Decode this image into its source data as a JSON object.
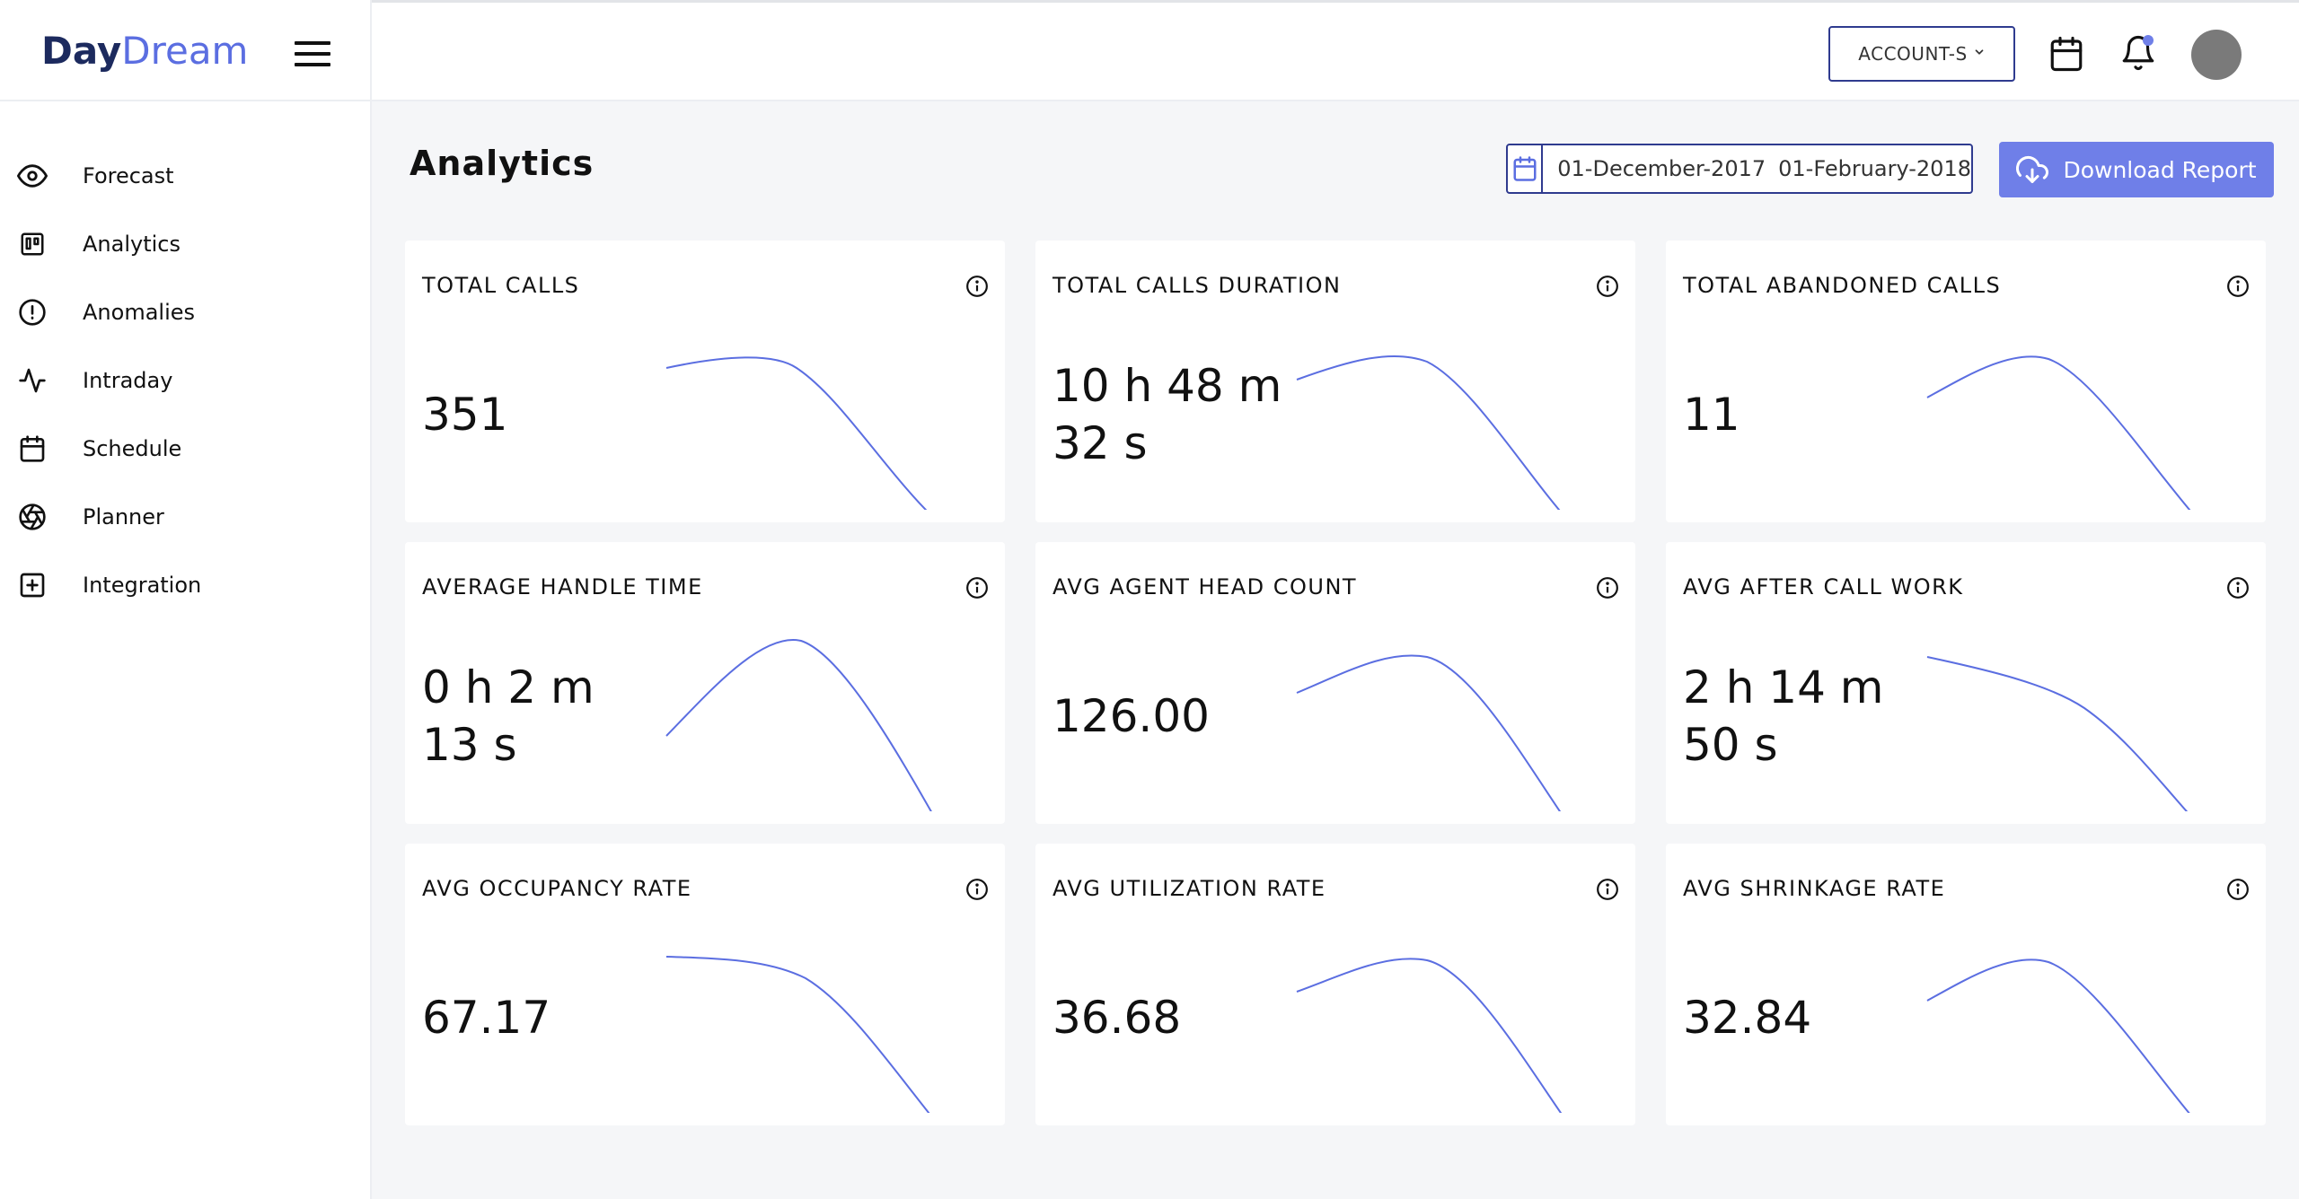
{
  "app": {
    "logo_day": "Day",
    "logo_dream": "Dream"
  },
  "sidebar": {
    "items": [
      {
        "label": "Forecast",
        "icon": "eye-icon"
      },
      {
        "label": "Analytics",
        "icon": "board-icon"
      },
      {
        "label": "Anomalies",
        "icon": "alert-circle-icon"
      },
      {
        "label": "Intraday",
        "icon": "activity-icon"
      },
      {
        "label": "Schedule",
        "icon": "calendar-icon"
      },
      {
        "label": "Planner",
        "icon": "aperture-icon"
      },
      {
        "label": "Integration",
        "icon": "plus-square-icon"
      }
    ]
  },
  "topbar": {
    "account_label": "ACCOUNT-S",
    "notification_dot": true
  },
  "main": {
    "title": "Analytics",
    "date_start": "01-December-2017",
    "date_end": "01-February-2018",
    "download_label": "Download Report"
  },
  "colors": {
    "accent": "#6f7fe8",
    "brand_dark": "#1c2a5e",
    "sparkline": "#5b6ee1"
  },
  "cards": [
    {
      "title": "TOTAL CALLS",
      "value": "351",
      "trend": "rise-fall-late"
    },
    {
      "title": "TOTAL CALLS DURATION",
      "value": "10 h 48 m 32 s",
      "trend": "rise-fall"
    },
    {
      "title": "TOTAL ABANDONED CALLS",
      "value": "11",
      "trend": "rise-fall"
    },
    {
      "title": "AVERAGE HANDLE TIME",
      "value": "0 h 2 m 13 s",
      "trend": "peak"
    },
    {
      "title": "AVG AGENT HEAD COUNT",
      "value": "126.00",
      "trend": "rise-fall"
    },
    {
      "title": "AVG AFTER CALL WORK",
      "value": "2 h 14 m 50 s",
      "trend": "decline"
    },
    {
      "title": "AVG OCCUPANCY RATE",
      "value": "67.17",
      "trend": "plateau-fall"
    },
    {
      "title": "AVG UTILIZATION RATE",
      "value": "36.68",
      "trend": "rise-fall"
    },
    {
      "title": "AVG SHRINKAGE RATE",
      "value": "32.84",
      "trend": "rise-fall"
    }
  ]
}
